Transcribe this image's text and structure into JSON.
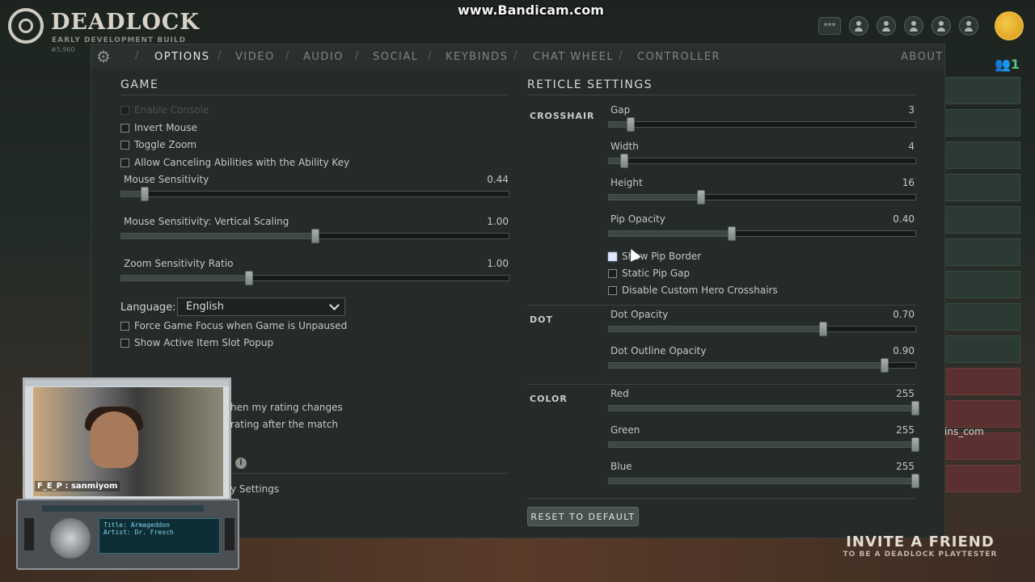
{
  "app": {
    "logo_title": "DEADLOCK",
    "logo_subtitle": "EARLY DEVELOPMENT BUILD",
    "build": "#5,960",
    "watermark": "www.Bandicam.com",
    "stars": "***",
    "online_count": "1"
  },
  "tabs": [
    {
      "label": "OPTIONS",
      "active": true
    },
    {
      "label": "VIDEO"
    },
    {
      "label": "AUDIO"
    },
    {
      "label": "SOCIAL"
    },
    {
      "label": "KEYBINDS"
    },
    {
      "label": "CHAT WHEEL"
    },
    {
      "label": "CONTROLLER"
    },
    {
      "label": "ABOUT"
    }
  ],
  "game": {
    "title": "GAME",
    "checkboxes": [
      {
        "label": "Enable Console",
        "checked": false,
        "disabled": true
      },
      {
        "label": "Invert Mouse",
        "checked": false
      },
      {
        "label": "Toggle Zoom",
        "checked": false
      },
      {
        "label": "Allow Canceling Abilities with the Ability Key",
        "checked": false
      }
    ],
    "sliders": [
      {
        "label": "Mouse Sensitivity",
        "value": "0.44",
        "fraction": 0.06
      },
      {
        "label": "Mouse Sensitivity: Vertical Scaling",
        "value": "1.00",
        "fraction": 0.5
      },
      {
        "label": "Zoom Sensitivity Ratio",
        "value": "1.00",
        "fraction": 0.33
      }
    ],
    "language_label": "Language:",
    "language_value": "English",
    "checkboxes2": [
      {
        "label": "Force Game Focus when Game is Unpaused",
        "checked": false
      },
      {
        "label": "Show Active Item Slot Popup",
        "checked": false
      }
    ],
    "partial_lines": [
      "hen my rating changes",
      "rating after the match",
      "y Settings"
    ]
  },
  "reticle": {
    "title": "RETICLE SETTINGS",
    "crosshair_label": "CROSSHAIR",
    "crosshair_sliders": [
      {
        "label": "Gap",
        "value": "3",
        "fraction": 0.07
      },
      {
        "label": "Width",
        "value": "4",
        "fraction": 0.05
      },
      {
        "label": "Height",
        "value": "16",
        "fraction": 0.3
      },
      {
        "label": "Pip Opacity",
        "value": "0.40",
        "fraction": 0.4
      }
    ],
    "crosshair_checkboxes": [
      {
        "label": "Show Pip Border",
        "checked": false,
        "focused": true
      },
      {
        "label": "Static Pip Gap",
        "checked": false
      },
      {
        "label": "Disable Custom Hero Crosshairs",
        "checked": false
      }
    ],
    "dot_label": "DOT",
    "dot_sliders": [
      {
        "label": "Dot Opacity",
        "value": "0.70",
        "fraction": 0.7
      },
      {
        "label": "Dot Outline Opacity",
        "value": "0.90",
        "fraction": 0.9
      }
    ],
    "color_label": "COLOR",
    "color_sliders": [
      {
        "label": "Red",
        "value": "255",
        "fraction": 1.0
      },
      {
        "label": "Green",
        "value": "255",
        "fraction": 1.0
      },
      {
        "label": "Blue",
        "value": "255",
        "fraction": 1.0
      }
    ],
    "reset_label": "RESET TO DEFAULT"
  },
  "overlay": {
    "chat_line": "F_E_P : sanmiyom",
    "radio_title": "Title: Armageddon",
    "radio_artist": "Artist: Dr. Fresch",
    "chat_fragment": "ins_com",
    "invite_big": "INVITE A FRIEND",
    "invite_small": "TO BE A DEADLOCK PLAYTESTER"
  }
}
